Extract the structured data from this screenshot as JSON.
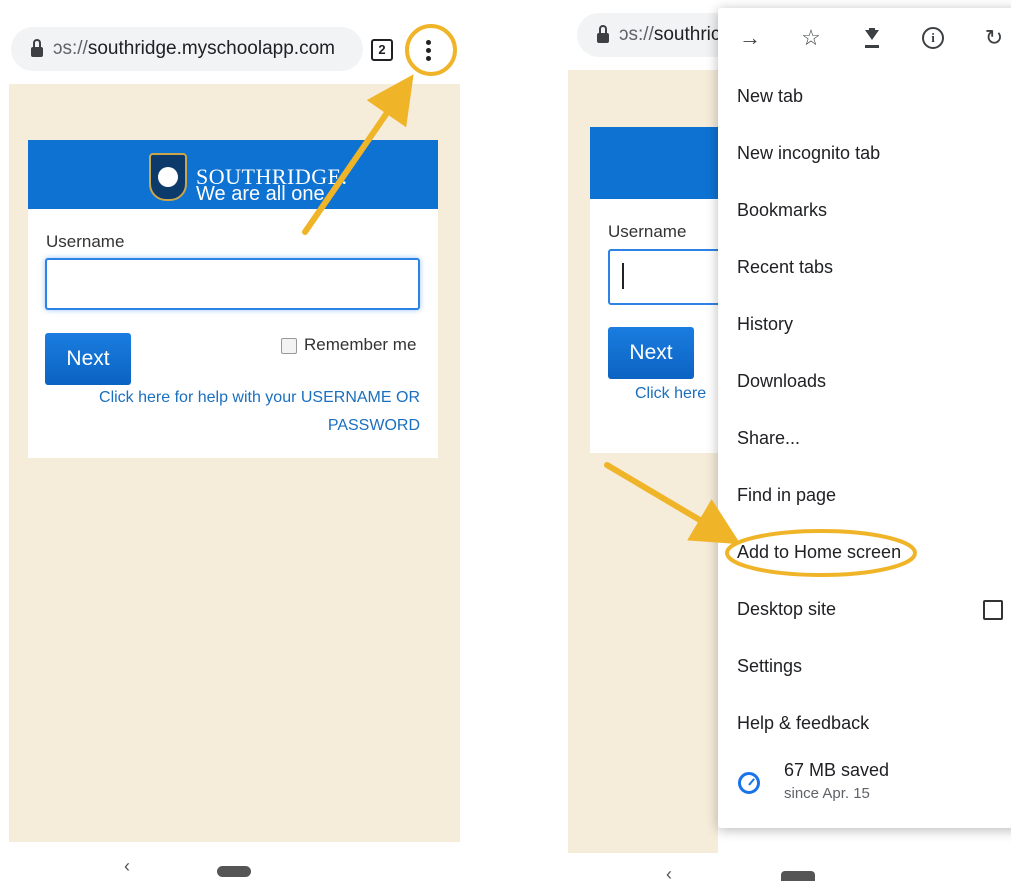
{
  "left": {
    "url_prefix": "ɔs://",
    "url_host": "southridge.myschoolapp.com",
    "tab_count": "2",
    "brand_name": "SOUTHRIDGE.",
    "brand_tagline": "We are all one",
    "username_label": "Username",
    "username_value": "",
    "next_label": "Next",
    "remember_label": "Remember me",
    "help_line1": "Click here for help with your USERNAME OR",
    "help_line2": "PASSWORD",
    "nav_back": "‹"
  },
  "right": {
    "url_prefix": "ɔs://",
    "url_host": "southric",
    "username_label": "Username",
    "next_label": "Next",
    "help_partial": "Click here",
    "nav_back": "‹"
  },
  "menu": {
    "icons": [
      "forward-icon",
      "star-icon",
      "download-icon",
      "info-icon",
      "reload-icon"
    ],
    "items": [
      {
        "label": "New tab"
      },
      {
        "label": "New incognito tab"
      },
      {
        "label": "Bookmarks"
      },
      {
        "label": "Recent tabs"
      },
      {
        "label": "History"
      },
      {
        "label": "Downloads"
      },
      {
        "label": "Share..."
      },
      {
        "label": "Find in page"
      },
      {
        "label": "Add to Home screen"
      },
      {
        "label": "Desktop site"
      },
      {
        "label": "Settings"
      },
      {
        "label": "Help & feedback"
      }
    ],
    "savings_main": "67 MB saved",
    "savings_sub": "since Apr. 15"
  },
  "annotation_color": "#f0b429"
}
